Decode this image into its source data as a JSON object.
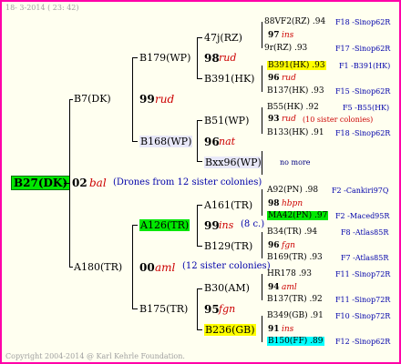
{
  "header": {
    "date": "18-  3-2014 ( 23: 42)"
  },
  "footer": {
    "copyright": "Copyright 2004-2014 @ Karl Kehrle Foundation."
  },
  "root": {
    "label": "B27(DK)"
  },
  "gen1": {
    "top": {
      "name": "B7(DK)",
      "num": "99",
      "tag": "rud"
    },
    "bottom": {
      "name": "A180(TR)",
      "num": "00",
      "tag": "aml",
      "note": "(12 sister colonies)"
    },
    "root_num": "02",
    "root_tag": "bal",
    "root_note": "(Drones from 12 sister colonies)"
  },
  "gen2": {
    "b179": {
      "name": "B179(WP)",
      "num": "98",
      "tag": "rud"
    },
    "b168": {
      "name": "B168(WP)",
      "num": "96",
      "tag": "nat"
    },
    "a126": {
      "name": "A126(TR)",
      "num": "99",
      "tag": "ins",
      "note": "(8 c.)"
    },
    "b175": {
      "name": "B175(TR)",
      "num": "95",
      "tag": "fgn"
    }
  },
  "gen3": {
    "r47j": {
      "name": "47j(RZ)",
      "num": "97",
      "tag": "ins"
    },
    "b391": {
      "name": "B391(HK)",
      "num": "96",
      "tag": "rud"
    },
    "b51": {
      "name": "B51(WP)",
      "num": "93",
      "tag": "rud",
      "note": "(10 sister colonies)"
    },
    "bxx96": {
      "name": "Bxx96(WP)",
      "extra": "no more"
    },
    "a161": {
      "name": "A161(TR)",
      "num": "98",
      "tag": "hbpn"
    },
    "b129": {
      "name": "B129(TR)",
      "num": "96",
      "tag": "fgn"
    },
    "b30": {
      "name": "B30(AM)",
      "num": "94",
      "tag": "aml"
    },
    "b236": {
      "name": "B236(GB)",
      "num": "91",
      "tag": "ins"
    }
  },
  "gen4": [
    {
      "name": "88VF2(RZ)",
      "val": ".94",
      "sire": "F18 -Sinop62R"
    },
    {
      "name": "9r(RZ)",
      "val": ".93",
      "sire": "F17 -Sinop62R"
    },
    {
      "name": "B391(HK)",
      "val": ".93",
      "sire": "F1 -B391(HK)"
    },
    {
      "name": "B137(HK)",
      "val": ".93",
      "sire": "F15 -Sinop62R"
    },
    {
      "name": "B55(HK)",
      "val": ".92",
      "sire": "F5 -B55(HK)"
    },
    {
      "name": "B133(HK)",
      "val": ".91",
      "sire": "F18 -Sinop62R"
    },
    {
      "name": "A92(PN)",
      "val": ".98",
      "sire": "F2 -Cankiri97Q"
    },
    {
      "name": "MA42(PN)",
      "val": ".97",
      "sire": "F2 -Maced95R"
    },
    {
      "name": "B34(TR)",
      "val": ".94",
      "sire": "F8 -Atlas85R"
    },
    {
      "name": "B169(TR)",
      "val": ".93",
      "sire": "F7 -Atlas85R"
    },
    {
      "name": "HR178",
      "val": ".93",
      "sire": "F11 -Sinop72R"
    },
    {
      "name": "B137(TR)",
      "val": ".92",
      "sire": "F11 -Sinop72R"
    },
    {
      "name": "B349(GB)",
      "val": ".91",
      "sire": "F10 -Sinop72R"
    },
    {
      "name": "B150(FF)",
      "val": ".89",
      "sire": "F12 -Sinop62R"
    }
  ]
}
